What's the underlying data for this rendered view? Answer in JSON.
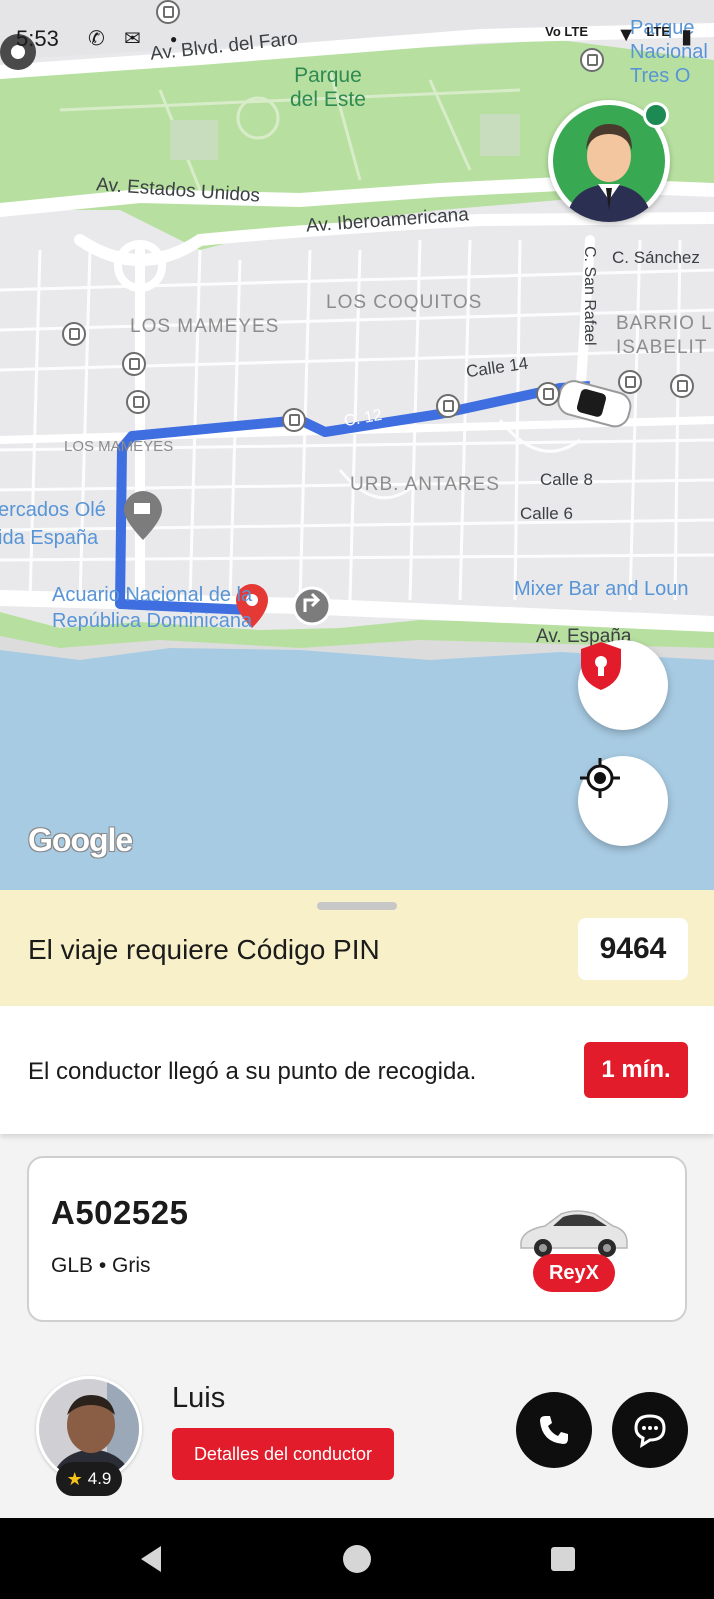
{
  "status_bar": {
    "time": "5:53",
    "network": "Vo LTE",
    "network2": "LTE"
  },
  "map": {
    "labels": {
      "road_faro": "Av. Blvd. del Faro",
      "park": "Parque\ndel Este",
      "park_right": "Parque\nNacional\nTres O",
      "road_eeuu": "Av. Estados Unidos",
      "road_ibero": "Av. Iberoamericana",
      "road_sanchez": "C. Sánchez",
      "road_sanrafael": "C. San Rafael",
      "hood_coquitos": "LOS COQUITOS",
      "hood_mameyes": "LOS MAMEYES",
      "hood_mameyes_small": "LOS MAMEYES",
      "hood_barrio": "BARRIO L\nISABELIT",
      "road_calle14": "Calle 14",
      "road_c12": "C. 12",
      "hood_antares": "URB. ANTARES",
      "road_calle8": "Calle 8",
      "road_calle6": "Calle 6",
      "poi_ole": "ercados Olé\nida España",
      "poi_acuario": "Acuario Nacional de la\nRepública Dominicana",
      "poi_mixer": "Mixer Bar and Loun",
      "road_espana": "Av. España",
      "google": "Google"
    }
  },
  "pin": {
    "label": "El viaje requiere Código PIN",
    "code": "9464"
  },
  "arrival": {
    "message": "El conductor llegó a su punto de recogida.",
    "eta": "1 mín."
  },
  "vehicle": {
    "plate": "A502525",
    "description": "GLB • Gris",
    "brand": "ReyX"
  },
  "driver": {
    "name": "Luis",
    "rating": "4.9",
    "details_label": "Detalles del conductor"
  },
  "colors": {
    "accent_red": "#e21c2a",
    "route_blue": "#3f6ee0",
    "pin_band": "#f8f0c8",
    "park_green": "#a9dc8a",
    "water_blue": "#a7cbe3"
  }
}
